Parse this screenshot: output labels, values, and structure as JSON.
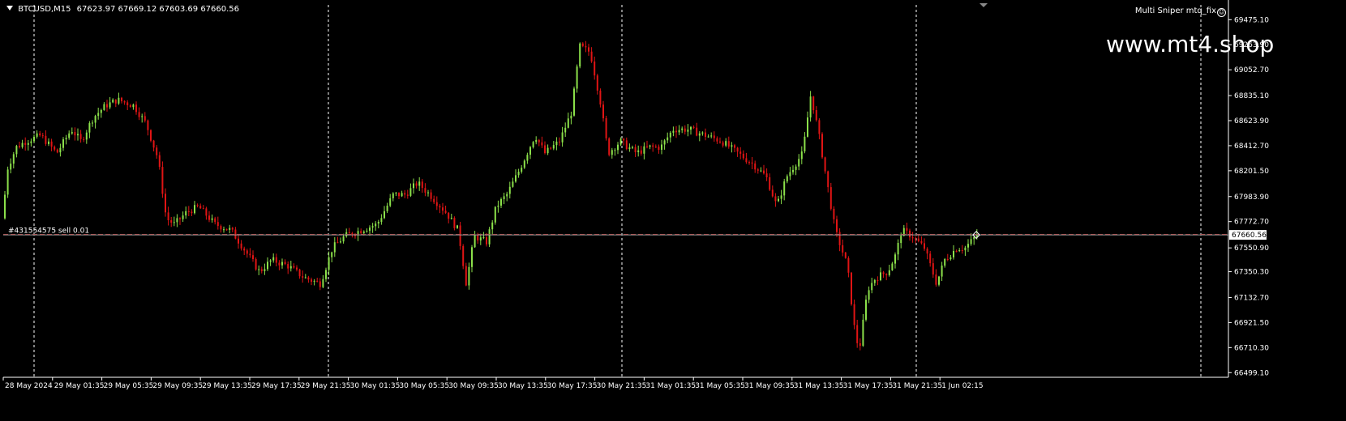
{
  "header": {
    "symbol": "BTCUSD,M15",
    "ohlc": "67623.97 67669.12 67603.69 67660.56"
  },
  "indicator": {
    "label": "Multi Sniper mtq_fix"
  },
  "watermark": "www.mt4.shop",
  "order": {
    "label": "#431554575 sell 0.01",
    "price": 67665
  },
  "current_price_label": "67660.56",
  "colors": {
    "bull": "#8BE04A",
    "bear": "#E01414",
    "background": "#000000",
    "axis": "#FFFFFF",
    "order_line": "#B03030",
    "price_line": "#A0A0A0"
  },
  "chart_data": {
    "type": "candlestick",
    "symbol": "BTCUSD",
    "timeframe": "M15",
    "y_ticks": [
      "69475.10",
      "69263.90",
      "69052.70",
      "68835.10",
      "68623.90",
      "68412.70",
      "68201.50",
      "67983.90",
      "67772.70",
      "67550.90",
      "67350.30",
      "67132.70",
      "66921.50",
      "66710.30",
      "66499.10"
    ],
    "ylim": [
      66460,
      69600
    ],
    "x_labels": [
      "28 May 2024",
      "29 May 01:35",
      "29 May 05:35",
      "29 May 09:35",
      "29 May 13:35",
      "29 May 17:35",
      "29 May 21:35",
      "30 May 01:35",
      "30 May 05:35",
      "30 May 09:35",
      "30 May 13:35",
      "30 May 17:35",
      "30 May 21:35",
      "31 May 01:35",
      "31 May 05:35",
      "31 May 09:35",
      "31 May 13:35",
      "31 May 17:35",
      "31 May 21:35",
      "1 Jun 02:15"
    ],
    "price_path": [
      [
        0,
        67400
      ],
      [
        8,
        68200
      ],
      [
        20,
        68400
      ],
      [
        32,
        68450
      ],
      [
        50,
        68500
      ],
      [
        70,
        68350
      ],
      [
        88,
        68550
      ],
      [
        100,
        68450
      ],
      [
        115,
        68650
      ],
      [
        130,
        68750
      ],
      [
        145,
        68800
      ],
      [
        165,
        68750
      ],
      [
        180,
        68600
      ],
      [
        195,
        68300
      ],
      [
        205,
        67800
      ],
      [
        215,
        67750
      ],
      [
        230,
        67850
      ],
      [
        245,
        67900
      ],
      [
        265,
        67750
      ],
      [
        285,
        67700
      ],
      [
        305,
        67500
      ],
      [
        320,
        67350
      ],
      [
        335,
        67450
      ],
      [
        355,
        67400
      ],
      [
        375,
        67300
      ],
      [
        395,
        67250
      ],
      [
        410,
        67550
      ],
      [
        425,
        67650
      ],
      [
        445,
        67700
      ],
      [
        465,
        67750
      ],
      [
        485,
        68000
      ],
      [
        500,
        68000
      ],
      [
        515,
        68100
      ],
      [
        530,
        68000
      ],
      [
        550,
        67850
      ],
      [
        565,
        67700
      ],
      [
        575,
        67250
      ],
      [
        585,
        67650
      ],
      [
        600,
        67600
      ],
      [
        612,
        67900
      ],
      [
        625,
        68000
      ],
      [
        640,
        68200
      ],
      [
        660,
        68500
      ],
      [
        672,
        68350
      ],
      [
        690,
        68450
      ],
      [
        705,
        68700
      ],
      [
        715,
        69250
      ],
      [
        728,
        69200
      ],
      [
        740,
        68800
      ],
      [
        750,
        68350
      ],
      [
        765,
        68450
      ],
      [
        785,
        68350
      ],
      [
        800,
        68400
      ],
      [
        815,
        68400
      ],
      [
        830,
        68550
      ],
      [
        850,
        68550
      ],
      [
        870,
        68500
      ],
      [
        890,
        68450
      ],
      [
        910,
        68350
      ],
      [
        930,
        68250
      ],
      [
        945,
        68150
      ],
      [
        958,
        67900
      ],
      [
        970,
        68150
      ],
      [
        990,
        68350
      ],
      [
        1000,
        68850
      ],
      [
        1010,
        68500
      ],
      [
        1020,
        68100
      ],
      [
        1030,
        67700
      ],
      [
        1045,
        67400
      ],
      [
        1055,
        66800
      ],
      [
        1060,
        66700
      ],
      [
        1070,
        67200
      ],
      [
        1080,
        67300
      ],
      [
        1095,
        67350
      ],
      [
        1105,
        67500
      ],
      [
        1112,
        67700
      ],
      [
        1125,
        67650
      ],
      [
        1140,
        67550
      ],
      [
        1155,
        67250
      ],
      [
        1165,
        67450
      ],
      [
        1180,
        67550
      ],
      [
        1190,
        67550
      ],
      [
        1205,
        67660
      ]
    ],
    "last_price": 67660.56
  }
}
